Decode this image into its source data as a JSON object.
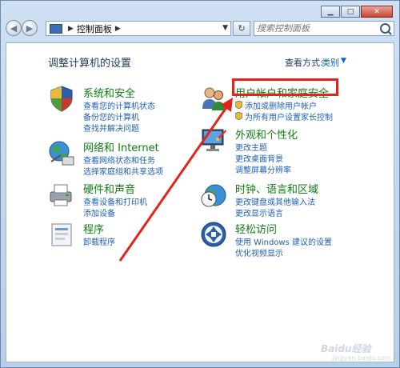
{
  "address": {
    "path": "控制面板"
  },
  "search": {
    "placeholder": "搜索控制面板"
  },
  "page": {
    "title": "调整计算机的设置"
  },
  "viewby": {
    "label": "查看方式:",
    "value": "类别"
  },
  "categories": [
    {
      "id": "security",
      "icon": "shield-icon",
      "title": "系统和安全",
      "links": [
        "查看您的计算机状态",
        "备份您的计算机",
        "查找并解决问题"
      ]
    },
    {
      "id": "network",
      "icon": "globe-network-icon",
      "title": "网络和 Internet",
      "links": [
        "查看网络状态和任务",
        "选择家庭组和共享选项"
      ]
    },
    {
      "id": "hardware",
      "icon": "printer-icon",
      "title": "硬件和声音",
      "links": [
        "查看设备和打印机",
        "添加设备"
      ]
    },
    {
      "id": "programs",
      "icon": "programs-icon",
      "title": "程序",
      "links": [
        "卸载程序"
      ]
    },
    {
      "id": "accounts",
      "icon": "users-icon",
      "title": "用户帐户和家庭安全",
      "links": [
        "添加或删除用户帐户",
        "为所有用户设置家长控制"
      ]
    },
    {
      "id": "appearance",
      "icon": "monitor-paint-icon",
      "title": "外观和个性化",
      "links": [
        "更改主题",
        "更改桌面背景",
        "调整屏幕分辨率"
      ]
    },
    {
      "id": "clock",
      "icon": "clock-globe-icon",
      "title": "时钟、语言和区域",
      "links": [
        "更改键盘或其他输入法",
        "更改显示语言"
      ]
    },
    {
      "id": "access",
      "icon": "ease-of-access-icon",
      "title": "轻松访问",
      "links": [
        "使用 Windows 建议的设置",
        "优化视频显示"
      ]
    }
  ],
  "colors": {
    "category_title": "#0e7e13",
    "link": "#1e5fb5",
    "highlight": "#e2241b"
  },
  "watermark": {
    "brand": "Baidu经验",
    "site": "jingyan.baidu.com"
  }
}
